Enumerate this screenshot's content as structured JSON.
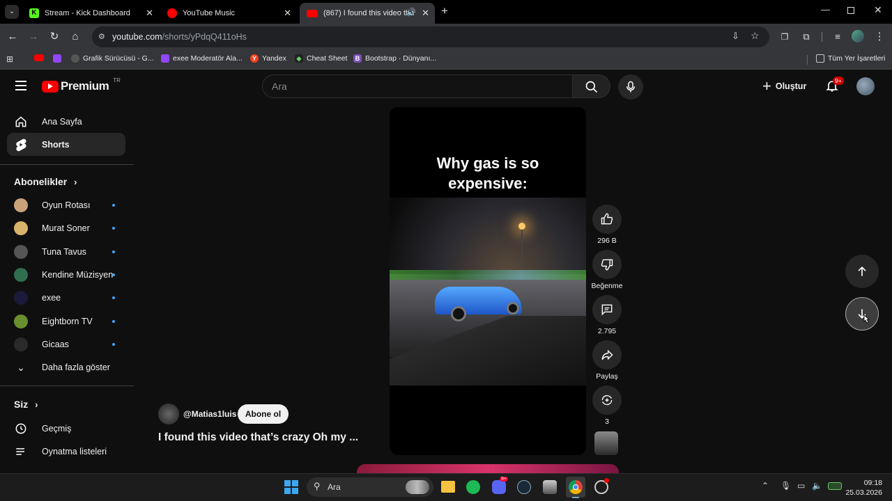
{
  "browser": {
    "tabs": [
      {
        "title": "Stream - Kick Dashboard",
        "favicon_color": "#53fc18",
        "favicon_letter": "K"
      },
      {
        "title": "YouTube Music",
        "favicon_color": "#ff0000",
        "favicon_letter": ""
      },
      {
        "title": "(867) I found this video tha",
        "favicon_color": "#ff0000",
        "favicon_letter": "",
        "active": true
      }
    ],
    "url_host": "youtube.com",
    "url_path": "/shorts/yPdqQ411oHs",
    "bookmarks": [
      {
        "label": "",
        "color": "#ff0000"
      },
      {
        "label": "",
        "color": "#9146ff"
      },
      {
        "label": "Grafik Sürücüsü - G...",
        "color": "#555555"
      },
      {
        "label": "exee Moderatör Ala...",
        "color": "#9146ff"
      },
      {
        "label": "Yandex",
        "color": "#fc3f1d",
        "letter": "Y"
      },
      {
        "label": "Cheat Sheet",
        "color": "#222222"
      },
      {
        "label": "Bootstrap · Dünyanı...",
        "color": "#7952b3",
        "letter": "B"
      }
    ],
    "all_bookmarks": "Tüm Yer İşaretleri"
  },
  "youtube": {
    "logo_text": "Premium",
    "region": "TR",
    "search_placeholder": "Ara",
    "create_label": "Oluştur",
    "notif_count": "9+",
    "sidebar": {
      "main": [
        {
          "label": "Ana Sayfa",
          "icon": "home-icon"
        },
        {
          "label": "Shorts",
          "icon": "shorts-icon",
          "active": true
        }
      ],
      "subs_heading": "Abonelikler",
      "subscriptions": [
        {
          "label": "Oyun Rotası",
          "color": "#c9a27a"
        },
        {
          "label": "Murat Soner",
          "color": "#d9b36b"
        },
        {
          "label": "Tuna Tavus",
          "color": "#555555"
        },
        {
          "label": "Kendine Müzisyen",
          "color": "#2f6e4f"
        },
        {
          "label": "exee",
          "color": "#1a1a3a"
        },
        {
          "label": "Eightborn TV",
          "color": "#6a8f2f"
        },
        {
          "label": "Gicaas",
          "color": "#2a2a2a"
        }
      ],
      "show_more": "Daha fazla göster",
      "you_heading": "Siz",
      "you_items": [
        {
          "label": "Geçmiş",
          "icon": "history-icon"
        },
        {
          "label": "Oynatma listeleri",
          "icon": "playlist-icon"
        }
      ]
    },
    "short": {
      "caption_line1": "Why gas is so",
      "caption_line2": "expensive:",
      "channel": "@Matias1luis",
      "subscribe": "Abone ol",
      "title": "I found this video that’s crazy Oh my ...",
      "likes": "296 B",
      "dislike_label": "Beğenme",
      "comments": "2.795",
      "share_label": "Paylaş",
      "remix_count": "3"
    }
  },
  "taskbar": {
    "search_label": "Ara",
    "time": "09:18",
    "date": "25.03.2026",
    "discord_badge": "9+"
  }
}
